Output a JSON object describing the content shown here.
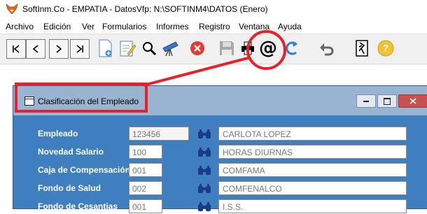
{
  "window": {
    "title": "SoftInm.Co - EMPATIA - DatosVfp: N:\\SOFTINM4\\DATOS  (Enero)"
  },
  "menu": [
    "Archivo",
    "Edición",
    "Ver",
    "Formularios",
    "Informes",
    "Registro",
    "Ventana",
    "Ayuda"
  ],
  "toolbar": {
    "buttons": [
      "first-record-icon",
      "previous-record-icon",
      "next-record-icon",
      "last-record-icon",
      "new-document-icon",
      "edit-document-icon",
      "search-icon",
      "telescope-icon",
      "delete-icon",
      "save-icon",
      "print-icon",
      "email-icon",
      "refresh-icon",
      "undo-icon",
      "exit-icon",
      "help-icon"
    ],
    "email_glyph": "@",
    "help_glyph": "?"
  },
  "form": {
    "title": "Clasificación del Empleado",
    "fields": [
      {
        "label": "Empleado",
        "code": "123456",
        "description": "CARLOTA LOPEZ"
      },
      {
        "label": "Novedad Salario",
        "code": "100",
        "description": "HORAS DIURNAS"
      },
      {
        "label": "Caja de Compensación",
        "code": "001",
        "description": "COMFAMA"
      },
      {
        "label": "Fondo de Salud",
        "code": "002",
        "description": "COMFENALCO"
      },
      {
        "label": "Fondo de Cesantias",
        "code": "001",
        "description": "I.S.S."
      }
    ]
  },
  "colors": {
    "accent": "#e8202a",
    "form_background": "#3f7fbf",
    "inner_title_bar": "#99b4d1"
  }
}
